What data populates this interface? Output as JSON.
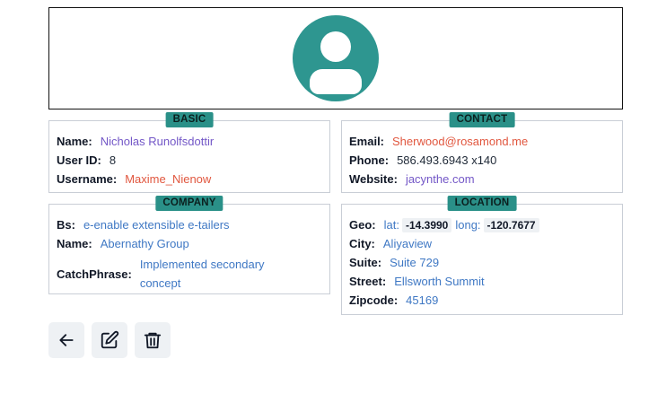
{
  "basic": {
    "title": "BASIC",
    "name_label": "Name:",
    "name_value": "Nicholas Runolfsdottir",
    "userid_label": "User ID:",
    "userid_value": "8",
    "username_label": "Username:",
    "username_value": "Maxime_Nienow"
  },
  "contact": {
    "title": "CONTACT",
    "email_label": "Email:",
    "email_value": "Sherwood@rosamond.me",
    "phone_label": "Phone:",
    "phone_value": "586.493.6943 x140",
    "website_label": "Website:",
    "website_value": "jacynthe.com"
  },
  "company": {
    "title": "COMPANY",
    "bs_label": "Bs:",
    "bs_value": "e-enable extensible e-tailers",
    "name_label": "Name:",
    "name_value": "Abernathy Group",
    "catchphrase_label": "CatchPhrase:",
    "catchphrase_value": "Implemented secondary concept"
  },
  "location": {
    "title": "LOCATION",
    "geo_label": "Geo:",
    "lat_label": "lat:",
    "lat_value": "-14.3990",
    "long_label": "long:",
    "long_value": "-120.7677",
    "city_label": "City:",
    "city_value": "Aliyaview",
    "suite_label": "Suite:",
    "suite_value": "Suite 729",
    "street_label": "Street:",
    "street_value": "Ellsworth Summit",
    "zipcode_label": "Zipcode:",
    "zipcode_value": "45169"
  },
  "icons": {
    "avatar": "user-circle-icon",
    "back": "arrow-left-icon",
    "edit": "edit-icon",
    "delete": "trash-icon"
  },
  "colors": {
    "accent": "#2e9690",
    "badge": "#2a9088",
    "purple_value": "#7357c7",
    "red_value": "#e1573f",
    "blue_value": "#3f78c4",
    "button_bg": "#eef1f4"
  }
}
